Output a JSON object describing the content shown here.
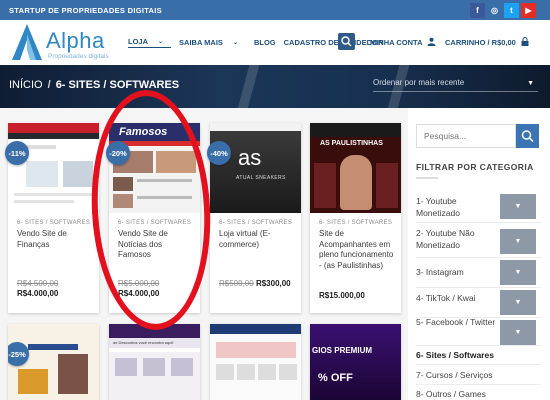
{
  "topbar": {
    "text": "STARTUP DE PROPRIEDADES DIGITAIS",
    "social": [
      {
        "icon": "facebook-icon",
        "glyph": "f",
        "color": "#3b5998"
      },
      {
        "icon": "instagram-icon",
        "glyph": "◎",
        "color": "#3a6ea8"
      },
      {
        "icon": "twitter-icon",
        "glyph": "t",
        "color": "#1da1f2"
      },
      {
        "icon": "youtube-icon",
        "glyph": "▶",
        "color": "#e52d27"
      }
    ]
  },
  "header": {
    "logo_name": "Alpha",
    "logo_sub": "Propriedades digitais",
    "nav": [
      "LOJA",
      "SAIBA MAIS",
      "BLOG",
      "CADASTRO DE VENDEDOR"
    ],
    "account": "MINHA CONTA",
    "cart": "CARRINHO / R$0,00"
  },
  "banner": {
    "breadcrumb_home": "INÍCIO",
    "breadcrumb_sep": "/",
    "breadcrumb_current": "6- SITES / SOFTWARES",
    "orderby": "Ordenar por mais recente"
  },
  "products": [
    {
      "badge": "-11%",
      "category": "6- SITES / SOFTWARES",
      "title": "Vendo Site de Finanças",
      "old_price": "R$4.500,00",
      "new_price": "R$4.000,00"
    },
    {
      "badge": "-20%",
      "category": "6- SITES / SOFTWARES",
      "title": "Vendo Site de Notícias dos Famosos",
      "old_price": "R$5.000,00",
      "new_price": "R$4.000,00",
      "thumb_text": "Famosos"
    },
    {
      "badge": "-40%",
      "category": "6- SITES / SOFTWARES",
      "title": "Loja virtual (E-commerce)",
      "old_price": "R$500,00",
      "new_price": "R$300,00",
      "thumb_text": "as",
      "thumb_sub": "ATUAL SNEAKERS"
    },
    {
      "badge": "",
      "category": "6- SITES / SOFTWARES",
      "title": "Site de Acompanhantes em pleno funcionamento - (as Paulistinhas)",
      "old_price": "",
      "new_price": "R$15.000,00",
      "thumb_text": "AS PAULISTINHAS"
    }
  ],
  "products_row2": [
    {
      "badge": "-25%"
    },
    {
      "thumb_text": "de Descontos você encontra aqui!"
    },
    {},
    {
      "thumb_text": "GIOS PREMIUM",
      "thumb_sub": "% OFF"
    }
  ],
  "sidebar": {
    "search_placeholder": "Pesquisa...",
    "filter_title": "FILTRAR POR CATEGORIA",
    "categories": [
      {
        "label": "1- Youtube Monetizado",
        "toggle": true
      },
      {
        "label": "2- Youtube Não Monetizado",
        "toggle": true
      },
      {
        "label": "3- Instagram",
        "toggle": true
      },
      {
        "label": "4- TikTok / Kwai",
        "toggle": true
      },
      {
        "label": "5- Facebook / Twitter",
        "toggle": true
      },
      {
        "label": "6- Sites / Softwares",
        "toggle": false,
        "active": true
      },
      {
        "label": "7- Cursos / Serviços",
        "toggle": false
      },
      {
        "label": "8- Outros / Games",
        "toggle": false
      }
    ]
  },
  "colors": {
    "brand": "#3a6ea8",
    "annotation": "#e3101e"
  }
}
